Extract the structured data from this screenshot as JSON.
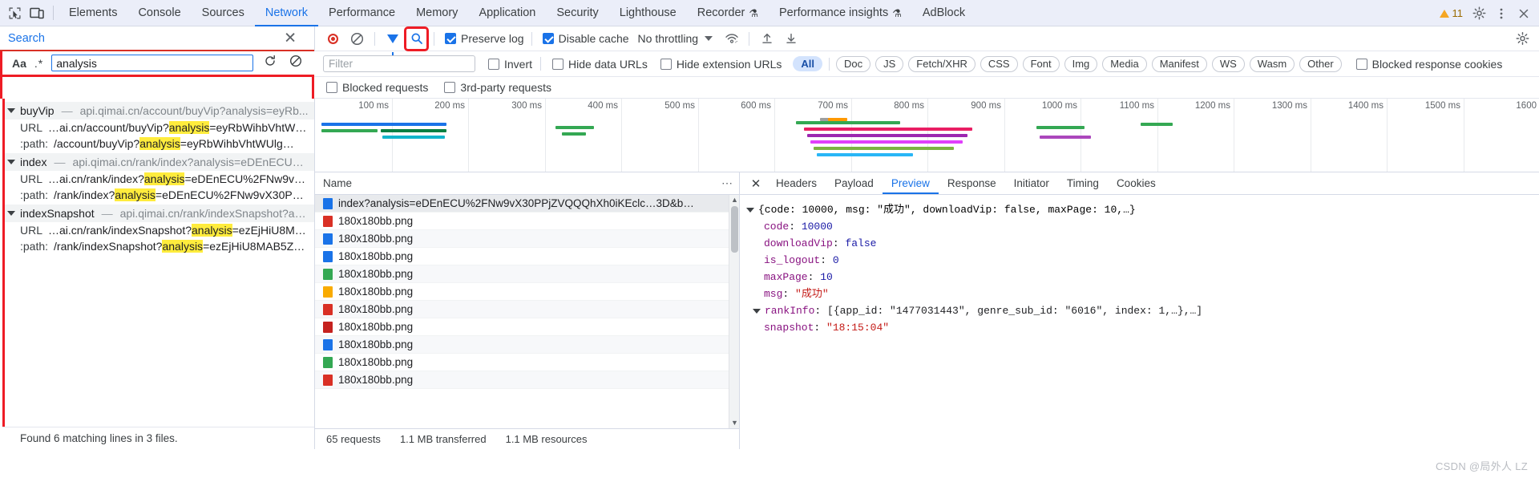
{
  "devtools": {
    "tabs": [
      {
        "label": "Elements",
        "active": false,
        "flask": false
      },
      {
        "label": "Console",
        "active": false,
        "flask": false
      },
      {
        "label": "Sources",
        "active": false,
        "flask": false
      },
      {
        "label": "Network",
        "active": true,
        "flask": false
      },
      {
        "label": "Performance",
        "active": false,
        "flask": false
      },
      {
        "label": "Memory",
        "active": false,
        "flask": false
      },
      {
        "label": "Application",
        "active": false,
        "flask": false
      },
      {
        "label": "Security",
        "active": false,
        "flask": false
      },
      {
        "label": "Lighthouse",
        "active": false,
        "flask": false
      },
      {
        "label": "Recorder",
        "active": false,
        "flask": true
      },
      {
        "label": "Performance insights",
        "active": false,
        "flask": true
      },
      {
        "label": "AdBlock",
        "active": false,
        "flask": false
      }
    ],
    "warning_count": "11",
    "icons": {
      "inspect": "inspect-element-icon",
      "device": "device-toolbar-icon",
      "settings": "gear-icon",
      "more": "more-vertical-icon",
      "close": "close-icon",
      "warning": "warning-triangle-icon"
    }
  },
  "search_panel": {
    "title": "Search",
    "close_label": "✕",
    "match_case_label": "Aa",
    "regex_label": ".*",
    "query": "analysis",
    "query_placeholder": "Search",
    "refresh_label": "↻",
    "clear_label": "⊘",
    "status": "Found 6 matching lines in 3 files.",
    "results": [
      {
        "name": "buyVip",
        "url": "api.qimai.cn/account/buyVip?analysis=eyRb...",
        "lines": [
          {
            "label": "URL",
            "pre": "…ai.cn/account/buyVip?",
            "match": "analysis",
            "post": "=eyRbWihbVhtW…"
          },
          {
            "label": ":path:",
            "pre": "/account/buyVip?",
            "match": "analysis",
            "post": "=eyRbWihbVhtWUlg…"
          }
        ]
      },
      {
        "name": "index",
        "url": "api.qimai.cn/rank/index?analysis=eDEnECU%…",
        "lines": [
          {
            "label": "URL",
            "pre": "…ai.cn/rank/index?",
            "match": "analysis",
            "post": "=eDEnECU%2FNw9vX…"
          },
          {
            "label": ":path:",
            "pre": "/rank/index?",
            "match": "analysis",
            "post": "=eDEnECU%2FNw9vX30PPj…"
          }
        ]
      },
      {
        "name": "indexSnapshot",
        "url": "api.qimai.cn/rank/indexSnapshot?an…",
        "lines": [
          {
            "label": "URL",
            "pre": "…ai.cn/rank/indexSnapshot?",
            "match": "analysis",
            "post": "=ezEjHiU8M…"
          },
          {
            "label": ":path:",
            "pre": "/rank/indexSnapshot?",
            "match": "analysis",
            "post": "=ezEjHiU8MAB5Z…"
          }
        ]
      }
    ]
  },
  "network_toolbar": {
    "record_label": "record-button",
    "clear_label": "clear-button",
    "filter_label": "filter-button",
    "search_label": "search-button",
    "preserve_log": {
      "label": "Preserve log",
      "checked": true
    },
    "disable_cache": {
      "label": "Disable cache",
      "checked": true
    },
    "throttling": "No throttling",
    "import_label": "import-har-icon",
    "export_label": "export-har-icon",
    "wifi_label": "network-conditions-icon",
    "settings_label": "settings-gear-icon"
  },
  "filter_bar": {
    "filter_placeholder": "Filter",
    "filter_value": "",
    "invert": {
      "label": "Invert",
      "checked": false
    },
    "hide_data_urls": {
      "label": "Hide data URLs",
      "checked": false
    },
    "hide_extension_urls": {
      "label": "Hide extension URLs",
      "checked": false
    },
    "types": [
      "All",
      "Doc",
      "JS",
      "Fetch/XHR",
      "CSS",
      "Font",
      "Img",
      "Media",
      "Manifest",
      "WS",
      "Wasm",
      "Other"
    ],
    "active_type": "All",
    "blocked_response_cookies": {
      "label": "Blocked response cookies",
      "checked": false
    },
    "blocked_requests": {
      "label": "Blocked requests",
      "checked": false
    },
    "third_party_requests": {
      "label": "3rd-party requests",
      "checked": false
    }
  },
  "overview": {
    "ticks": [
      "100 ms",
      "200 ms",
      "300 ms",
      "400 ms",
      "500 ms",
      "600 ms",
      "700 ms",
      "800 ms",
      "900 ms",
      "1000 ms",
      "1100 ms",
      "1200 ms",
      "1300 ms",
      "1400 ms",
      "1500 ms",
      "1600"
    ]
  },
  "request_list": {
    "column_header": "Name",
    "selected_row": "index?analysis=eDEnECU%2FNw9vX30PPjZVQQQhXh0iKEclc…3D&b…",
    "rows": [
      {
        "name": "index?analysis=eDEnECU%2FNw9vX30PPjZVQQQhXh0iKEclc…3D&b…",
        "color": "#1a73e8",
        "selected": true
      },
      {
        "name": "180x180bb.png",
        "color": "#d93025",
        "selected": false
      },
      {
        "name": "180x180bb.png",
        "color": "#1a73e8",
        "selected": false
      },
      {
        "name": "180x180bb.png",
        "color": "#1a73e8",
        "selected": false
      },
      {
        "name": "180x180bb.png",
        "color": "#34a853",
        "selected": false
      },
      {
        "name": "180x180bb.png",
        "color": "#f9ab00",
        "selected": false
      },
      {
        "name": "180x180bb.png",
        "color": "#d93025",
        "selected": false
      },
      {
        "name": "180x180bb.png",
        "color": "#c5221f",
        "selected": false
      },
      {
        "name": "180x180bb.png",
        "color": "#1a73e8",
        "selected": false
      },
      {
        "name": "180x180bb.png",
        "color": "#34a853",
        "selected": false
      },
      {
        "name": "180x180bb.png",
        "color": "#d93025",
        "selected": false
      }
    ],
    "status": {
      "requests": "65 requests",
      "transferred": "1.1 MB transferred",
      "resources": "1.1 MB resources"
    }
  },
  "detail": {
    "close_label": "✕",
    "tabs": [
      "Headers",
      "Payload",
      "Preview",
      "Response",
      "Initiator",
      "Timing",
      "Cookies"
    ],
    "active_tab": "Preview",
    "preview": {
      "summary_prefix": "{code: ",
      "summary": "{code: 10000, msg: \"成功\", downloadVip: false, maxPage: 10,…}",
      "rows": [
        {
          "key": "code",
          "value": "10000",
          "type": "num"
        },
        {
          "key": "downloadVip",
          "value": "false",
          "type": "bool"
        },
        {
          "key": "is_logout",
          "value": "0",
          "type": "num"
        },
        {
          "key": "maxPage",
          "value": "10",
          "type": "num"
        },
        {
          "key": "msg",
          "value": "\"成功\"",
          "type": "str"
        },
        {
          "key": "rankInfo",
          "value": "[{app_id: \"1477031443\", genre_sub_id: \"6016\", index: 1,…},…]",
          "type": "punc",
          "expandable": true
        },
        {
          "key": "snapshot",
          "value": "\"18:15:04\"",
          "type": "str"
        }
      ]
    }
  },
  "watermark": "CSDN @局外人 LZ",
  "colors": {
    "accent": "#1a73e8",
    "highlight": "#ffec3d",
    "red_box": "#ee1c25",
    "tab_bg": "#ebeef9"
  }
}
